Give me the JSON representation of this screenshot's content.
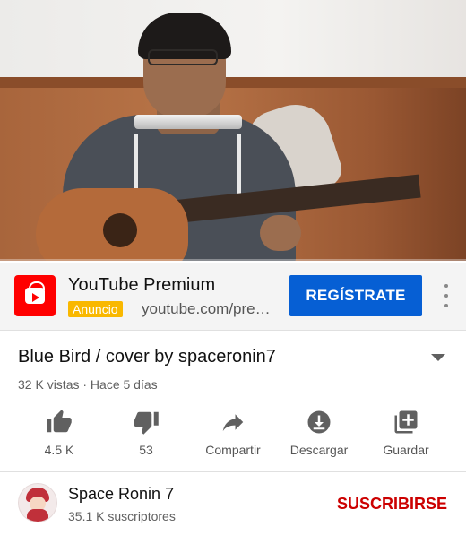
{
  "video": {
    "progress_fraction": 0.0,
    "accent_color": "#ff0000"
  },
  "ad": {
    "title": "YouTube Premium",
    "badge": "Anuncio",
    "url": "youtube.com/pre…",
    "cta": "REGÍSTRATE",
    "logo_icon": "youtube-premium-logo-icon",
    "menu_icon": "more-vert-icon",
    "cta_color": "#065fd4",
    "badge_color": "#f9b800"
  },
  "info": {
    "title": "Blue Bird / cover by spaceronin7",
    "meta": "32 K vistas · Hace 5 días",
    "expand_icon": "expand-caret-icon"
  },
  "actions": [
    {
      "label": "4.5 K",
      "icon": "thumb-up-icon"
    },
    {
      "label": "53",
      "icon": "thumb-down-icon"
    },
    {
      "label": "Compartir",
      "icon": "share-icon"
    },
    {
      "label": "Descargar",
      "icon": "download-icon"
    },
    {
      "label": "Guardar",
      "icon": "playlist-add-icon"
    }
  ],
  "channel": {
    "name": "Space Ronin 7",
    "subscribers": "35.1 K suscriptores",
    "subscribe_label": "SUSCRIBIRSE",
    "subscribe_color": "#cc0000"
  }
}
